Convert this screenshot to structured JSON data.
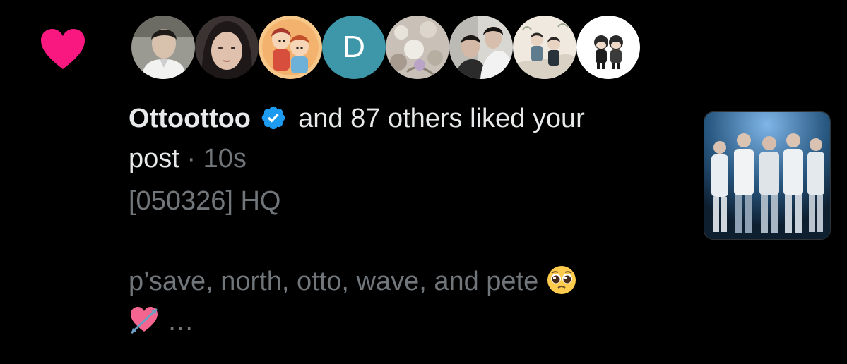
{
  "notification": {
    "type_icon": "heart-icon",
    "accent_color": "#f91880",
    "avatars": [
      {
        "icon": "avatar-photo",
        "kind": "photo"
      },
      {
        "icon": "avatar-photo",
        "kind": "photo"
      },
      {
        "icon": "avatar-cartoon",
        "kind": "illustration"
      },
      {
        "icon": "avatar-letter",
        "kind": "letter",
        "letter": "D",
        "color": "#3d97a8"
      },
      {
        "icon": "avatar-photo",
        "kind": "photo"
      },
      {
        "icon": "avatar-photo",
        "kind": "photo"
      },
      {
        "icon": "avatar-illustration",
        "kind": "illustration"
      },
      {
        "icon": "avatar-cartoon",
        "kind": "illustration"
      }
    ],
    "username": "Ottoottoo",
    "verified_icon": "verified-badge-icon",
    "verified_color": "#1d9bf0",
    "action_text": "and 87 others liked your",
    "action_text_end": "post",
    "separator": " · ",
    "timestamp": "10s",
    "post_line1": "[050326] HQ",
    "post_line2": "p’save, north, otto, wave, and pete",
    "post_emoji1": "pleading-face-icon",
    "post_emoji2": "heart-with-arrow-icon",
    "ellipsis": "…",
    "thumbnail": "post-thumbnail-image"
  }
}
